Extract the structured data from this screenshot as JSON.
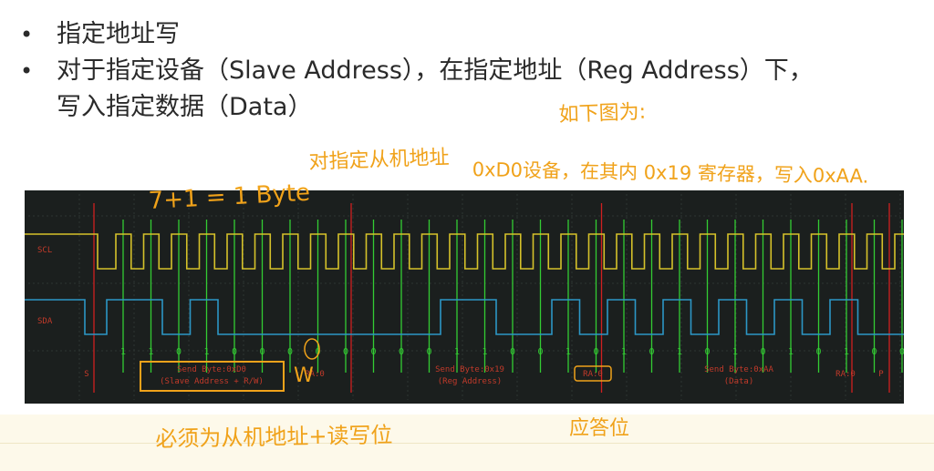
{
  "bullets": [
    {
      "text": "指定地址写"
    },
    {
      "text": "对于指定设备（Slave Address），在指定地址（Reg Address）下，"
    },
    {
      "text": "写入指定数据（Data）"
    }
  ],
  "bullet_symbol": "•",
  "annotations": {
    "as_shown": "如下图为:",
    "slave_addr": "对指定从机地址",
    "device_desc": "0xD0设备，在其内 0x19 寄存器，写入0xAA.",
    "byte_note": "7+1 = 1 Byte",
    "rw_mark": "W",
    "ack_note": "应答位",
    "bottom_note": "必须为从机地址+读写位"
  },
  "scope": {
    "scl_label": "SCL",
    "sda_label": "SDA",
    "bits": [
      "1",
      "1",
      "0",
      "1",
      "0",
      "0",
      "0",
      "0",
      "0",
      "0",
      "0",
      "0",
      "1",
      "1",
      "0",
      "0",
      "1",
      "0",
      "1",
      "0",
      "1",
      "0",
      "1",
      "0",
      "1",
      "0",
      "1",
      "0",
      "0"
    ],
    "segments": [
      {
        "label": "S"
      },
      {
        "label": "Send Byte:0xD0",
        "sub": "(Slave Address + R/W)"
      },
      {
        "label": "RA:0"
      },
      {
        "label": "Send Byte:0x19",
        "sub": "(Reg Address)"
      },
      {
        "label": "RA:0"
      },
      {
        "label": "Send Byte:0xAA",
        "sub": "(Data)"
      },
      {
        "label": "RA:0"
      },
      {
        "label": "P"
      }
    ]
  },
  "colors": {
    "annotation": "#f0a21a",
    "scope_bg": "#1b1f1e",
    "scl": "#d6c22a",
    "sda": "#2c97c6",
    "clock_marker": "#33cc33",
    "event_marker": "#d02020",
    "label": "#c23a2a"
  }
}
